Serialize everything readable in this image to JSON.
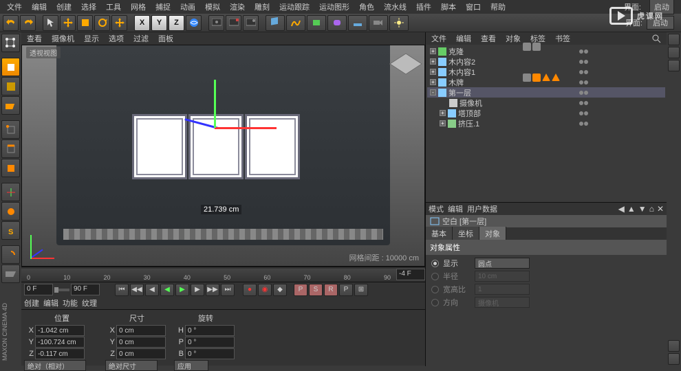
{
  "menu": [
    "文件",
    "编辑",
    "创建",
    "选择",
    "工具",
    "网格",
    "捕捉",
    "动画",
    "模拟",
    "渲染",
    "雕刻",
    "运动跟踪",
    "运动图形",
    "角色",
    "流水线",
    "插件",
    "脚本",
    "窗口",
    "帮助"
  ],
  "ui_label": "界面:",
  "ui_preset": "启动",
  "viewport_menu": [
    "查看",
    "摄像机",
    "显示",
    "选项",
    "过滤",
    "面板"
  ],
  "viewport_label": "透视视图",
  "measurement": "21.739 cm",
  "grid_label": "网格间距 : 10000 cm",
  "timeline": {
    "start": "0 F",
    "end": "90 F",
    "ticks": [
      "0",
      "10",
      "20",
      "30",
      "40",
      "50",
      "60",
      "70",
      "80",
      "90"
    ],
    "cur": "-4 F"
  },
  "bottom_menu": [
    "创建",
    "编辑",
    "功能",
    "纹理"
  ],
  "coords": {
    "headers": [
      "位置",
      "尺寸",
      "旋转"
    ],
    "pos": {
      "x": "-1.042 cm",
      "y": "-100.724 cm",
      "z": "-0.117 cm"
    },
    "size": {
      "x": "0 cm",
      "y": "0 cm",
      "z": "0 cm"
    },
    "rot": {
      "h": "0 °",
      "p": "0 °",
      "b": "0 °"
    },
    "mode1": "绝对（相对）",
    "mode2": "绝对尺寸",
    "apply": "应用"
  },
  "objmgr_menu": [
    "文件",
    "编辑",
    "查看",
    "对象",
    "标签",
    "书签"
  ],
  "objects": [
    {
      "name": "克隆",
      "depth": 0,
      "exp": "+",
      "icon": "#6c6"
    },
    {
      "name": "木内容2",
      "depth": 0,
      "exp": "+",
      "icon": "#8cf"
    },
    {
      "name": "木内容1",
      "depth": 0,
      "exp": "+",
      "icon": "#8cf"
    },
    {
      "name": "木牌",
      "depth": 0,
      "exp": "+",
      "icon": "#8cf"
    },
    {
      "name": "第一层",
      "depth": 0,
      "exp": "-",
      "icon": "#8cf",
      "sel": true
    },
    {
      "name": "摄像机",
      "depth": 1,
      "exp": "",
      "icon": "#ccc"
    },
    {
      "name": "塔顶部",
      "depth": 1,
      "exp": "+",
      "icon": "#8cf"
    },
    {
      "name": "挤压.1",
      "depth": 1,
      "exp": "+",
      "icon": "#8c8"
    }
  ],
  "attrmgr_menu": [
    "模式",
    "编辑",
    "用户数据"
  ],
  "attr_title": "空白 [第一层]",
  "attr_tabs": [
    "基本",
    "坐标",
    "对象"
  ],
  "attr_section": "对象属性",
  "attr_rows": {
    "display": "显示",
    "display_val": "圆点",
    "radius": "半径",
    "radius_val": "10 cm",
    "aspect": "宽高比",
    "aspect_val": "1",
    "orient": "方向",
    "orient_val": "摄像机"
  },
  "watermark": "虎课网",
  "brand": "MAXON CINEMA 4D"
}
